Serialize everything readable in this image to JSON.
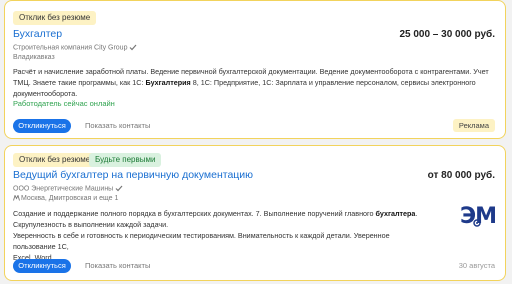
{
  "vacancies": [
    {
      "badges": [
        "Отклик без резюме"
      ],
      "title": "Бухгалтер",
      "salary": "25 000 – 30 000 руб.",
      "company": "Строительная компания City Group",
      "city": "Владикавказ",
      "description_parts": [
        "Расчёт и начисление заработной платы. Ведение первичной бухгалтерской документации. Ведение документооборота с контрагентами. Учет ТМЦ. Знаете такие программы, как 1С: ",
        "Бухгалтерия",
        " 8, 1С: Предприятие, 1С: Зарплата и управление персоналом, сервисы электронного документооборота."
      ],
      "online_status": "Работодатель сейчас онлайн",
      "apply_label": "Откликнуться",
      "contacts_label": "Показать контакты",
      "ad_label": "Реклама"
    },
    {
      "badges": [
        "Отклик без резюме",
        "Будьте первыми"
      ],
      "title": "Ведущий бухгалтер на первичную документацию",
      "salary": "от 80 000 руб.",
      "company": "ООО Энергетические Машины",
      "city": "Москва, Дмитровская и еще 1",
      "description_lines": [
        [
          "Создание и поддержание полного порядка в бухгалтерских документах. 7. Выполнение поручений главного ",
          "бухгалтера",
          "."
        ],
        [
          "Скрупулезность в выполнении каждой задачи."
        ],
        [
          "Уверенность в себе и готовность к периодическим тестированиям. Внимательность к каждой детали. Уверенное пользование 1С,"
        ],
        [
          "Excel, Word."
        ]
      ],
      "logo_text": "ЭМ",
      "apply_label": "Откликнуться",
      "contacts_label": "Показать контакты",
      "date": "30 августа"
    }
  ]
}
